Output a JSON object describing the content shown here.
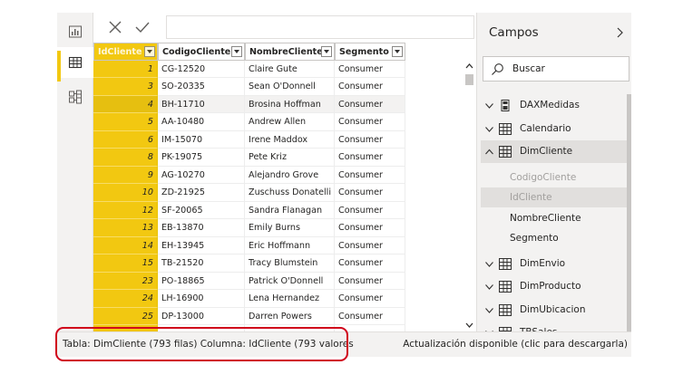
{
  "toolbar": {
    "cancel_icon": "close-icon",
    "commit_icon": "check-icon",
    "formula_value": ""
  },
  "rail": {
    "items": [
      "report-view-icon",
      "data-view-icon",
      "model-view-icon"
    ],
    "active_index": 1
  },
  "grid": {
    "columns": [
      "IdCliente",
      "CodigoCliente",
      "NombreCliente",
      "Segmento"
    ],
    "selected_column": "IdCliente",
    "selected_row_index": 2,
    "rows": [
      {
        "id": "1",
        "codigo": "CG-12520",
        "nombre": "Claire Gute",
        "segmento": "Consumer"
      },
      {
        "id": "3",
        "codigo": "SO-20335",
        "nombre": "Sean O'Donnell",
        "segmento": "Consumer"
      },
      {
        "id": "4",
        "codigo": "BH-11710",
        "nombre": "Brosina Hoffman",
        "segmento": "Consumer"
      },
      {
        "id": "5",
        "codigo": "AA-10480",
        "nombre": "Andrew Allen",
        "segmento": "Consumer"
      },
      {
        "id": "6",
        "codigo": "IM-15070",
        "nombre": "Irene Maddox",
        "segmento": "Consumer"
      },
      {
        "id": "8",
        "codigo": "PK-19075",
        "nombre": "Pete Kriz",
        "segmento": "Consumer"
      },
      {
        "id": "9",
        "codigo": "AG-10270",
        "nombre": "Alejandro Grove",
        "segmento": "Consumer"
      },
      {
        "id": "10",
        "codigo": "ZD-21925",
        "nombre": "Zuschuss Donatelli",
        "segmento": "Consumer"
      },
      {
        "id": "12",
        "codigo": "SF-20065",
        "nombre": "Sandra Flanagan",
        "segmento": "Consumer"
      },
      {
        "id": "13",
        "codigo": "EB-13870",
        "nombre": "Emily Burns",
        "segmento": "Consumer"
      },
      {
        "id": "14",
        "codigo": "EH-13945",
        "nombre": "Eric Hoffmann",
        "segmento": "Consumer"
      },
      {
        "id": "15",
        "codigo": "TB-21520",
        "nombre": "Tracy Blumstein",
        "segmento": "Consumer"
      },
      {
        "id": "23",
        "codigo": "PO-18865",
        "nombre": "Patrick O'Donnell",
        "segmento": "Consumer"
      },
      {
        "id": "24",
        "codigo": "LH-16900",
        "nombre": "Lena Hernandez",
        "segmento": "Consumer"
      },
      {
        "id": "25",
        "codigo": "DP-13000",
        "nombre": "Darren Powers",
        "segmento": "Consumer"
      },
      {
        "id": "",
        "codigo": "",
        "nombre": "",
        "segmento": ""
      }
    ]
  },
  "fields_pane": {
    "title": "Campos",
    "search_placeholder": "Buscar",
    "tables": [
      {
        "name": "DAXMedidas",
        "icon": "calculator-icon",
        "expanded": false
      },
      {
        "name": "Calendario",
        "icon": "table-icon",
        "expanded": false
      },
      {
        "name": "DimCliente",
        "icon": "table-icon",
        "expanded": true,
        "fields": [
          {
            "name": "CodigoCliente",
            "hidden": true
          },
          {
            "name": "IdCliente",
            "hidden": true,
            "selected": true
          },
          {
            "name": "NombreCliente",
            "hidden": false
          },
          {
            "name": "Segmento",
            "hidden": false
          }
        ]
      },
      {
        "name": "DimEnvio",
        "icon": "table-icon",
        "expanded": false
      },
      {
        "name": "DimProducto",
        "icon": "table-icon",
        "expanded": false
      },
      {
        "name": "DimUbicacion",
        "icon": "table-icon",
        "expanded": false
      },
      {
        "name": "TBSales",
        "icon": "table-icon",
        "expanded": false
      }
    ]
  },
  "status_bar": {
    "left_text": "Tabla: DimCliente (793 filas) Columna: IdCliente (793 valores",
    "right_text": "Actualización disponible (clic para descargarla)"
  },
  "colors": {
    "accent": "#f2c811",
    "highlight_border": "#d0021b",
    "pane_bg": "#f3f2f1"
  }
}
